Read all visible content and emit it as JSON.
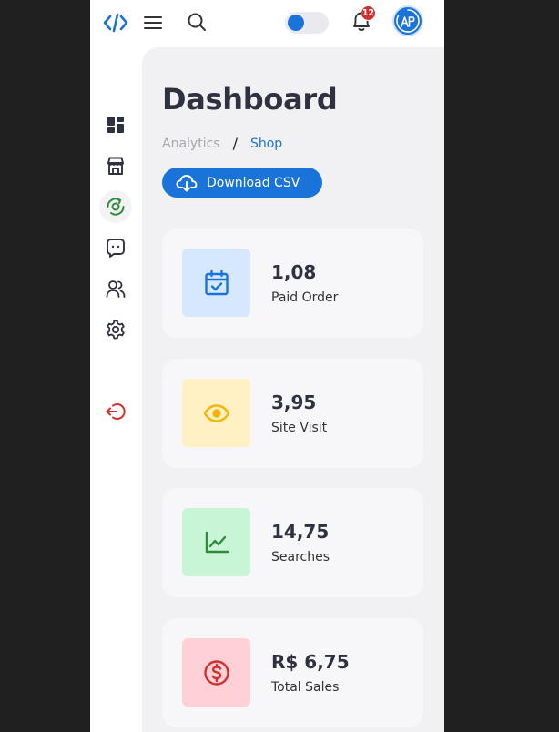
{
  "topbar": {
    "logo_icon": "code-brackets-icon",
    "notification_count": "12",
    "avatar_initials": "AP",
    "accent": "#1a73d9"
  },
  "sidebar": {
    "items": [
      {
        "icon": "dashboard-grid-icon",
        "active": false
      },
      {
        "icon": "store-icon",
        "active": false
      },
      {
        "icon": "analytics-circle-icon",
        "active": true
      },
      {
        "icon": "chat-bubble-icon",
        "active": false
      },
      {
        "icon": "users-icon",
        "active": false
      },
      {
        "icon": "settings-gear-icon",
        "active": false
      },
      {
        "icon": "logout-icon",
        "active": false
      }
    ]
  },
  "page": {
    "title": "Dashboard",
    "breadcrumb": {
      "parent": "Analytics",
      "separator": "/",
      "current": "Shop"
    },
    "download_label": "Download CSV"
  },
  "stats": [
    {
      "value": "1,08",
      "label": "Paid Order",
      "icon": "calendar-check-icon",
      "bg": "#d6e8ff",
      "fg": "#1a73d9"
    },
    {
      "value": "3,95",
      "label": "Site Visit",
      "icon": "eye-icon",
      "bg": "#fff1c4",
      "fg": "#f2b705"
    },
    {
      "value": "14,75",
      "label": "Searches",
      "icon": "line-chart-icon",
      "bg": "#c7f5d6",
      "fg": "#2e8b3a"
    },
    {
      "value": "R$ 6,75",
      "label": "Total Sales",
      "icon": "dollar-circle-icon",
      "bg": "#ffd1d6",
      "fg": "#d32f2f"
    }
  ]
}
